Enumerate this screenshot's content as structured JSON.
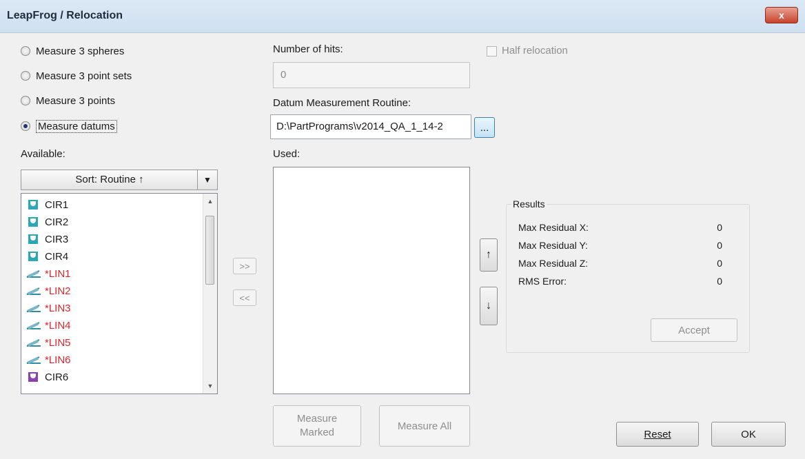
{
  "window": {
    "title": "LeapFrog / Relocation",
    "close_label": "x"
  },
  "mode_options": [
    {
      "label": "Measure 3 spheres",
      "selected": false
    },
    {
      "label": "Measure 3 point sets",
      "selected": false
    },
    {
      "label": "Measure 3 points",
      "selected": false
    },
    {
      "label": "Measure datums",
      "selected": true
    }
  ],
  "hits": {
    "label": "Number of hits:",
    "value": "0"
  },
  "half_relocation": {
    "label": "Half relocation",
    "checked": false
  },
  "datum_routine": {
    "label": "Datum Measurement Routine:",
    "value": "D:\\PartPrograms\\v2014_QA_1_14-2",
    "browse_label": "..."
  },
  "available": {
    "label": "Available:",
    "sort_label": "Sort: Routine ↑",
    "sort_dropdown": "▼",
    "items": [
      {
        "name": "CIR1",
        "icon": "circle-icon",
        "color": "#1b1b1b"
      },
      {
        "name": "CIR2",
        "icon": "circle-icon",
        "color": "#1b1b1b"
      },
      {
        "name": "CIR3",
        "icon": "circle-icon",
        "color": "#1b1b1b"
      },
      {
        "name": "CIR4",
        "icon": "circle-icon",
        "color": "#1b1b1b"
      },
      {
        "name": "*LIN1",
        "icon": "line-icon",
        "color": "#e0242c"
      },
      {
        "name": "*LIN2",
        "icon": "line-icon",
        "color": "#e0242c"
      },
      {
        "name": "*LIN3",
        "icon": "line-icon",
        "color": "#e0242c"
      },
      {
        "name": "*LIN4",
        "icon": "line-icon",
        "color": "#e0242c"
      },
      {
        "name": "*LIN5",
        "icon": "line-icon",
        "color": "#e0242c"
      },
      {
        "name": "*LIN6",
        "icon": "line-icon",
        "color": "#e0242c"
      },
      {
        "name": "CIR6",
        "icon": "circle-icon",
        "color": "#1b1b1b"
      }
    ]
  },
  "move_buttons": {
    "add": ">>",
    "remove": "<<"
  },
  "used": {
    "label": "Used:"
  },
  "reorder": {
    "up": "↑",
    "down": "↓"
  },
  "results": {
    "title": "Results",
    "rows": [
      {
        "label": "Max Residual X:",
        "value": "0"
      },
      {
        "label": "Max Residual Y:",
        "value": "0"
      },
      {
        "label": "Max Residual Z:",
        "value": "0"
      },
      {
        "label": "RMS Error:",
        "value": "0"
      }
    ],
    "accept_label": "Accept"
  },
  "actions": {
    "measure_marked_line1": "Measure",
    "measure_marked_line2": "Marked",
    "measure_all": "Measure All",
    "reset": "Reset",
    "ok": "OK"
  }
}
